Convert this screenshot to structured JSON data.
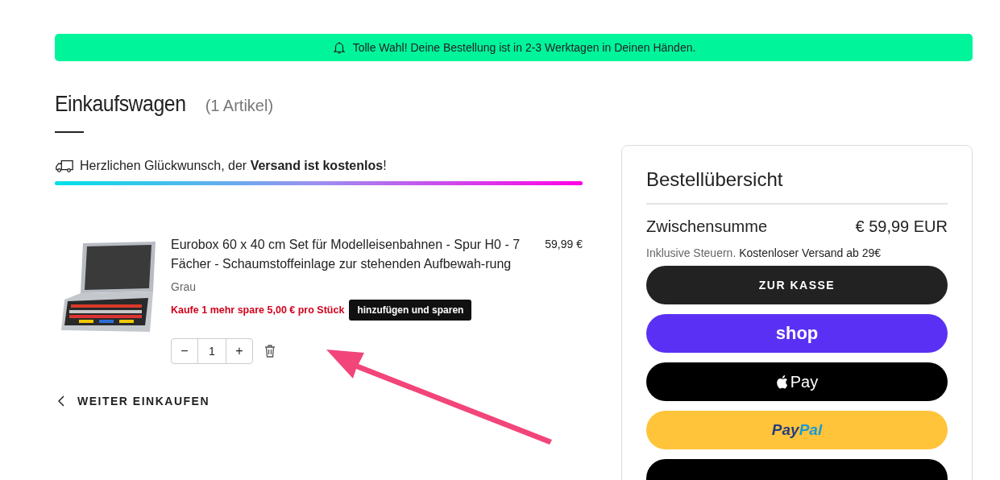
{
  "banner": {
    "text": "Tolle Wahl! Deine Bestellung ist in 2-3 Werktagen in Deinen Händen."
  },
  "cart": {
    "title": "Einkaufswagen",
    "count": "(1 Artikel)"
  },
  "shipping": {
    "message": "Herzlichen Glückwunsch, der **Versand ist kostenlos**!",
    "level": 1
  },
  "items": [
    {
      "kind": "picture",
      "name": "Eurobox 60 x 40 cm Set für Modelleisenbahnen - Spur H0 - 7 Fächer - Schaumstoffeinlage zur stehenden Aufbewah-rung",
      "variant": "Grau",
      "price": "59,99 €",
      "promo": "Kaufe **1** mehr spare **5,00 €** pro Stück",
      "promo_button": "hinzufügen und sparen",
      "quantity": "1",
      "minus": "−",
      "plus": "+"
    }
  ],
  "continue_link": "WEITER EINKAUFEN",
  "summary": {
    "title": "Bestellübersicht",
    "subtotal_label": "Zwischensumme",
    "subtotal": "€ 59,99 EUR",
    "note_muted": "Inklusive Steuern.",
    "note": "Kostenloser Versand ab 29€",
    "buttons": [
      {
        "kind": "checkout",
        "label": "ZUR KASSE"
      },
      {
        "kind": "shop",
        "label": "shop"
      },
      {
        "kind": "applepay",
        "label": "Pay"
      },
      {
        "kind": "paypal",
        "label": "Pay",
        "label2": "Pal"
      },
      {
        "kind": "blank"
      }
    ]
  },
  "annotation": {
    "kind": "arrow"
  }
}
